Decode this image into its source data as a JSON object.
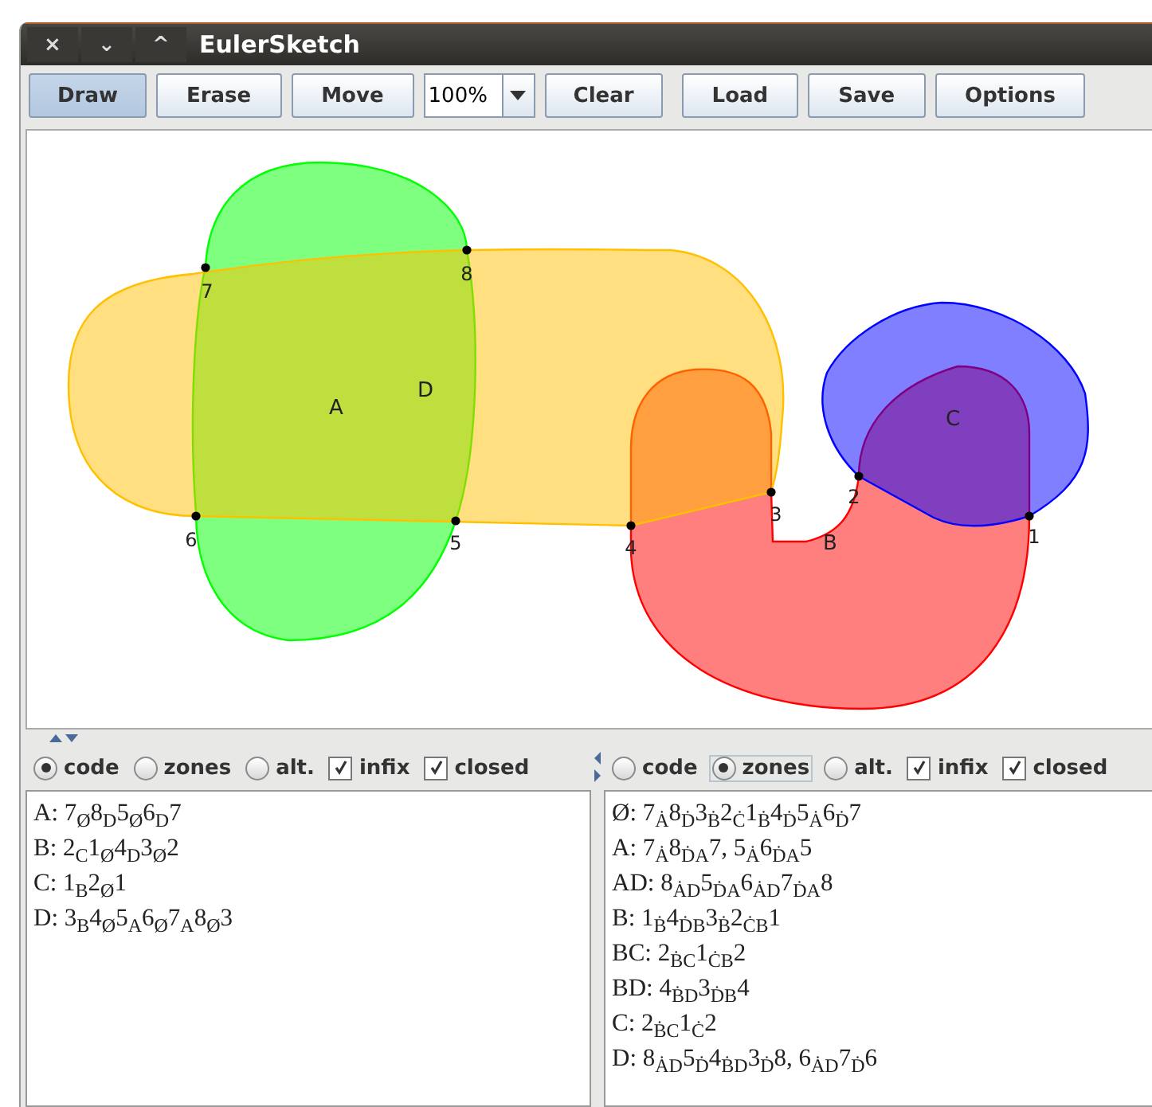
{
  "window": {
    "title": "EulerSketch",
    "controls": [
      "×",
      "⌄",
      "^"
    ]
  },
  "toolbar": {
    "buttons": [
      {
        "label": "Draw",
        "selected": true
      },
      {
        "label": "Erase",
        "selected": false
      },
      {
        "label": "Move",
        "selected": false
      }
    ],
    "zoom": "100%",
    "buttons_right": [
      {
        "label": "Clear"
      },
      {
        "label": "Load"
      },
      {
        "label": "Save"
      },
      {
        "label": "Options"
      }
    ]
  },
  "canvas": {
    "curves": [
      {
        "label": "A",
        "color": "#00ff00"
      },
      {
        "label": "B",
        "color": "#ff0000"
      },
      {
        "label": "C",
        "color": "#0000ff"
      },
      {
        "label": "D",
        "color": "#ffc000"
      }
    ],
    "points": [
      "7",
      "8",
      "6",
      "5",
      "4",
      "3",
      "2",
      "1"
    ]
  },
  "panels": [
    {
      "options": [
        {
          "kind": "radio",
          "label": "code",
          "selected": true
        },
        {
          "kind": "radio",
          "label": "zones",
          "selected": false
        },
        {
          "kind": "radio",
          "label": "alt.",
          "selected": false
        },
        {
          "kind": "checkbox",
          "label": "infix",
          "checked": true
        },
        {
          "kind": "checkbox",
          "label": "closed",
          "checked": true
        }
      ],
      "lines": [
        "A: 7$_{Ø}$8$_{D}$5$_{Ø}$6$_{D}$7",
        "B: 2$_{C}$1$_{Ø}$4$_{D}$3$_{Ø}$2",
        "C: 1$_{B}$2$_{Ø}$1",
        "D: 3$_{B}$4$_{Ø}$5$_{A}$6$_{Ø}$7$_{A}$8$_{Ø}$3"
      ]
    },
    {
      "options": [
        {
          "kind": "radio",
          "label": "code",
          "selected": false
        },
        {
          "kind": "radio",
          "label": "zones",
          "selected": true
        },
        {
          "kind": "radio",
          "label": "alt.",
          "selected": false
        },
        {
          "kind": "checkbox",
          "label": "infix",
          "checked": true
        },
        {
          "kind": "checkbox",
          "label": "closed",
          "checked": true
        }
      ],
      "lines": [
        "Ø: 7$_{Ȧ}$8$_{Ḋ}$3$_{Ḃ}$2$_{Ċ}$1$_{Ḃ}$4$_{Ḋ}$5$_{Ȧ}$6$_{Ḋ}$7",
        "A: 7$_{Ȧ}$8$_{ḊA}$7, 5$_{Ȧ}$6$_{ḊA}$5",
        "AD: 8$_{ȦD}$5$_{ḊA}$6$_{ȦD}$7$_{ḊA}$8",
        "B: 1$_{Ḃ}$4$_{ḊB}$3$_{Ḃ}$2$_{ĊB}$1",
        "BC: 2$_{ḂC}$1$_{ĊB}$2",
        "BD: 4$_{ḂD}$3$_{ḊB}$4",
        "C: 2$_{ḂC}$1$_{Ċ}$2",
        "D: 8$_{ȦD}$5$_{Ḋ}$4$_{ḂD}$3$_{Ḋ}$8, 6$_{ȦD}$7$_{Ḋ}$6"
      ]
    }
  ]
}
